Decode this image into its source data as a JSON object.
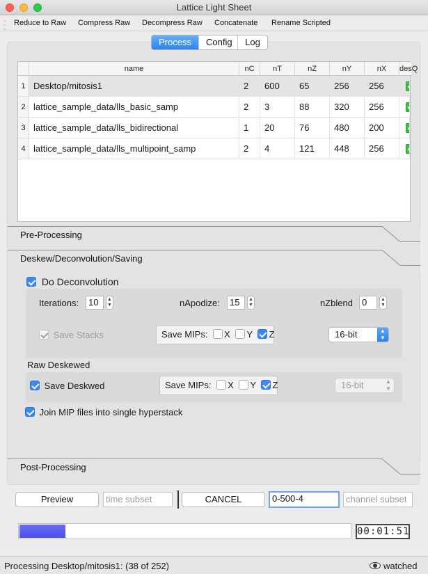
{
  "window": {
    "title": "Lattice Light Sheet"
  },
  "toolbar": {
    "items": [
      "Reduce to Raw",
      "Compress Raw",
      "Decompress Raw",
      "Concatenate",
      "Rename Scripted"
    ]
  },
  "tabs": [
    {
      "label": "Process",
      "active": true
    },
    {
      "label": "Config",
      "active": false
    },
    {
      "label": "Log",
      "active": false
    }
  ],
  "table": {
    "columns": [
      "name",
      "nC",
      "nT",
      "nZ",
      "nY",
      "nX",
      "desQ"
    ],
    "rows": [
      {
        "num": "1",
        "name": "Desktop/mitosis1",
        "nC": "2",
        "nT": "600",
        "nZ": "65",
        "nY": "256",
        "nX": "256",
        "desQ": true
      },
      {
        "num": "2",
        "name": "lattice_sample_data/lls_basic_samp",
        "nC": "2",
        "nT": "3",
        "nZ": "88",
        "nY": "320",
        "nX": "256",
        "desQ": true
      },
      {
        "num": "3",
        "name": "lattice_sample_data/lls_bidirectional",
        "nC": "1",
        "nT": "20",
        "nZ": "76",
        "nY": "480",
        "nX": "200",
        "desQ": true
      },
      {
        "num": "4",
        "name": "lattice_sample_data/lls_multipoint_samp",
        "nC": "2",
        "nT": "4",
        "nZ": "121",
        "nY": "448",
        "nX": "256",
        "desQ": true
      }
    ]
  },
  "sections": {
    "preprocessing": "Pre-Processing",
    "deskew": "Deskew/Deconvolution/Saving",
    "postprocessing": "Post-Processing"
  },
  "decon": {
    "do_label": "Do Deconvolution",
    "iterations_label": "Iterations:",
    "iterations_value": "10",
    "napodize_label": "nApodize:",
    "napodize_value": "15",
    "nzblend_label": "nZblend",
    "nzblend_value": "0",
    "save_stacks_label": "Save Stacks",
    "mips_label": "Save MIPs:",
    "bitdepth": "16-bit"
  },
  "raw_deskewed": {
    "heading": "Raw Deskewed",
    "save_label": "Save Deskwed",
    "mips_label": "Save MIPs:",
    "bitdepth": "16-bit"
  },
  "axes": [
    "X",
    "Y",
    "Z"
  ],
  "join_label": "Join MIP files into single hyperstack",
  "actions": {
    "preview": "Preview",
    "time_subset_placeholder": "time subset",
    "cancel": "CANCEL",
    "range_value": "0-500-4",
    "channel_subset_placeholder": "channel subset"
  },
  "progress": {
    "fraction": 0.138
  },
  "timer": "00:01:51",
  "status": {
    "text": "Processing Desktop/mitosis1: (38 of 252)",
    "watched": "watched"
  },
  "colors": {
    "accent": "#2a84f0",
    "progress": "#5457ec",
    "check": "#3ac141"
  }
}
